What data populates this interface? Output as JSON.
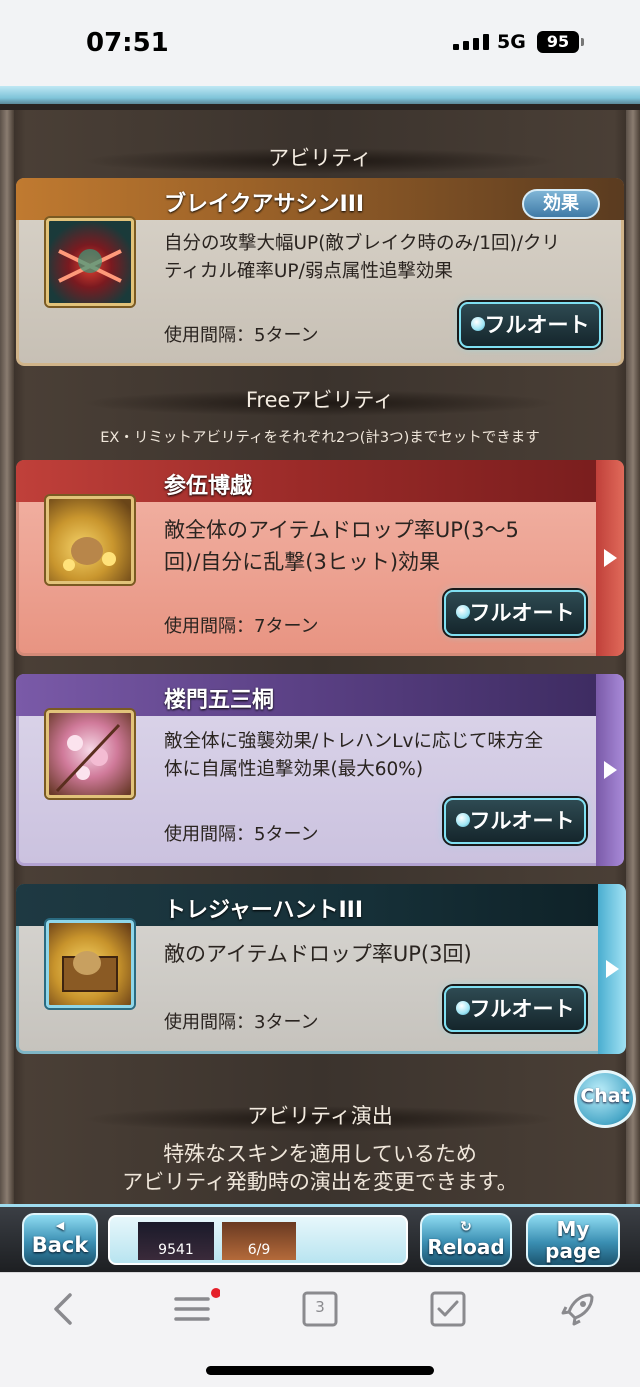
{
  "status_bar": {
    "time": "07:51",
    "network": "5G",
    "battery": "95"
  },
  "sections": {
    "ability_title": "アビリティ",
    "free_title": "Freeアビリティ",
    "free_note": "EX・リミットアビリティをそれぞれ2つ(計3つ)までセットできます",
    "effect_title": "アビリティ演出",
    "effect_note_1": "特殊なスキンを適用しているため",
    "effect_note_2": "アビリティ発動時の演出を変更できます。"
  },
  "abilities": [
    {
      "name": "ブレイクアサシンIII",
      "badge": "効果",
      "desc_1": "自分の攻撃大幅UP(敵ブレイク時のみ/1回)/クリ",
      "desc_2": "ティカル確率UP/弱点属性追撃効果",
      "cooldown": "使用間隔：5ターン",
      "button": "フルオート",
      "icon": "assassin-icon",
      "color": "#a46a2e"
    },
    {
      "name": "参伍博戯",
      "desc_1": "敵全体のアイテムドロップ率UP(3〜5",
      "desc_2": "回)/自分に乱撃(3ヒット)効果",
      "cooldown": "使用間隔：7ターン",
      "button": "フルオート",
      "icon": "treasure-bag-icon",
      "color": "#a5302e"
    },
    {
      "name": "楼門五三桐",
      "desc_1": "敵全体に強襲効果/トレハンLvに応じて味方全",
      "desc_2": "体に自属性追撃効果(最大60%)",
      "cooldown": "使用間隔：5ターン",
      "button": "フルオート",
      "icon": "cherry-blossom-icon",
      "color": "#6a4c9a"
    },
    {
      "name": "トレジャーハントIII",
      "desc_1": "敵のアイテムドロップ率UP(3回)",
      "cooldown": "使用間隔：3ターン",
      "button": "フルオート",
      "icon": "treasure-chest-icon",
      "color": "#1e3942"
    }
  ],
  "chat_label": "Chat",
  "gamebar": {
    "back": "Back",
    "counter_1": "9541",
    "counter_2": "6/9",
    "reload": "Reload",
    "mypage_1": "My",
    "mypage_2": "page"
  },
  "browser": {
    "tab_count": "3"
  }
}
